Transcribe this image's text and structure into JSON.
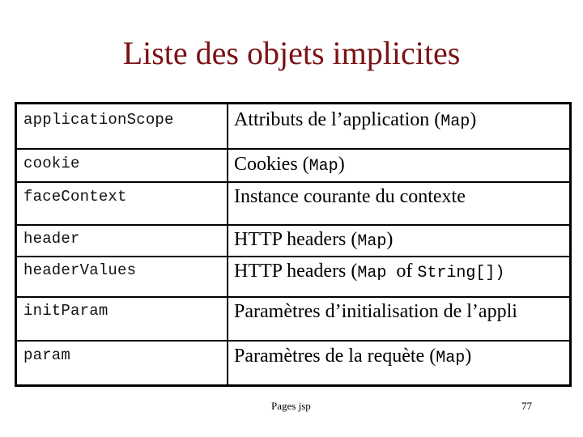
{
  "slide": {
    "title": "Liste des objets implicites",
    "footer": {
      "label": "Pages jsp",
      "page_number": "77"
    },
    "colors": {
      "title": "#7b1216",
      "border": "#000000",
      "text": "#000000"
    }
  },
  "table": {
    "rows": [
      {
        "name": "applicationScope",
        "desc_text": "Attributs de l’application (",
        "desc_mono": "Map",
        "desc_mid": "",
        "desc_mono2": "",
        "desc_end": ")"
      },
      {
        "name": "cookie",
        "desc_text": "Cookies (",
        "desc_mono": "Map",
        "desc_mid": "",
        "desc_mono2": "",
        "desc_end": ")"
      },
      {
        "name": "faceContext",
        "desc_text": "Instance courante du contexte",
        "desc_mono": "",
        "desc_mid": "",
        "desc_mono2": "",
        "desc_end": ""
      },
      {
        "name": "header",
        "desc_text": "HTTP headers (",
        "desc_mono": "Map",
        "desc_mid": "",
        "desc_mono2": "",
        "desc_end": ")"
      },
      {
        "name": "headerValues",
        "desc_text": "HTTP headers (",
        "desc_mono": "Map ",
        "desc_mid": "of ",
        "desc_mono2": "String[])",
        "desc_end": ""
      },
      {
        "name": "initParam",
        "desc_text": "Paramètres d’initialisation de l’appli",
        "desc_mono": "",
        "desc_mid": "",
        "desc_mono2": "",
        "desc_end": ""
      },
      {
        "name": "param",
        "desc_text": "Paramètres de la requète (",
        "desc_mono": "Map",
        "desc_mid": "",
        "desc_mono2": "",
        "desc_end": ")"
      }
    ]
  }
}
